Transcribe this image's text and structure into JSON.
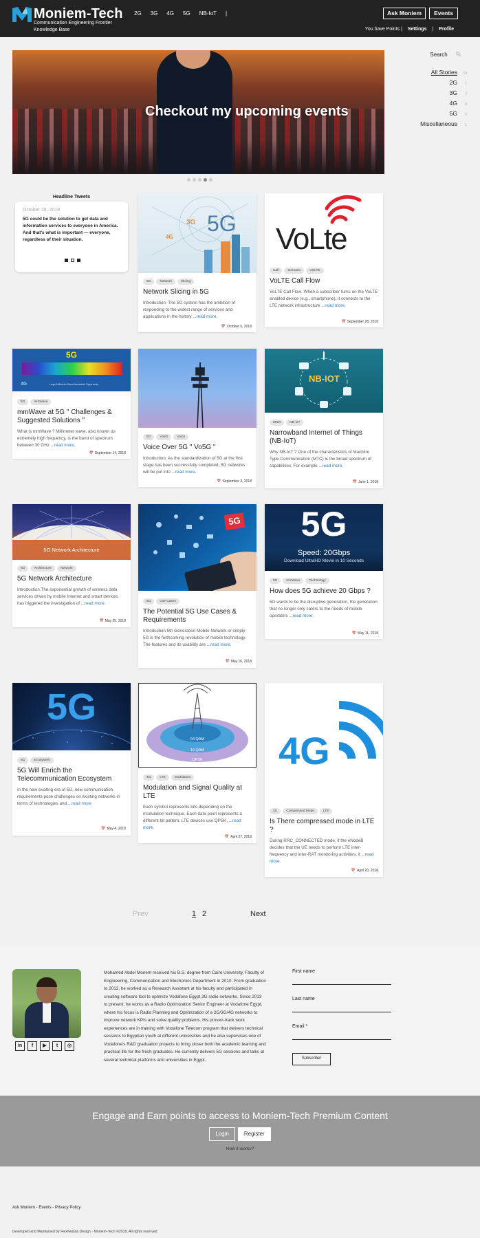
{
  "header": {
    "brand": "Moniem-Tech",
    "tagline_1": "Communication Engineering Frontier",
    "tagline_2": "Knowledge Base",
    "nav": [
      "2G",
      "3G",
      "4G",
      "5G",
      "NB-IoT",
      "|"
    ],
    "ask_button": "Ask Moniem",
    "events_button": "Events",
    "points_text": "You have Points",
    "settings_link": "Settings",
    "profile_link": "Profile"
  },
  "hero": {
    "caption": "Checkout my upcoming events"
  },
  "sidebar": {
    "search_label": "Search",
    "items": [
      {
        "label": "All Stories",
        "count": "19"
      },
      {
        "label": "2G",
        "count": "1"
      },
      {
        "label": "3G",
        "count": "2"
      },
      {
        "label": "4G",
        "count": "4"
      },
      {
        "label": "5G",
        "count": "5"
      },
      {
        "label": "Miscellaneous",
        "count": "1"
      }
    ]
  },
  "tweet": {
    "heading": "Headline Tweets",
    "date": "October 28, 2018",
    "text": "5G could be the solution to get data and information services to everyone in America. And that's what is important — everyone, regardless of their situation."
  },
  "cards": [
    {
      "img_text": "5G",
      "tags": [
        "5G",
        "Network",
        "Slicing"
      ],
      "title": "Network Slicing in 5G",
      "excerpt": "Introduction: The 5G system has the ambition of responding to the widest range of services and applications in the history ...",
      "read_more": "read more.",
      "date": "October 5, 2018"
    },
    {
      "img_text": "VoLte",
      "tags": [
        "Call",
        "Scenario",
        "VOLTE"
      ],
      "title": "VoLTE Call Flow",
      "excerpt": "VoLTE Call Flow: When a subscriber turns on the VoLTE enabled device (e.g., smartphone), it connects to the LTE network infrastructure ...",
      "read_more": "read more.",
      "date": "September 28, 2018"
    },
    {
      "img_text": "5G",
      "img_sub": "4G",
      "img_caption": "Large Millimeter Wave Bandwidth Opportunity",
      "tags": [
        "5G",
        "mmWave"
      ],
      "title": "mmWave at 5G \" Challenges & Suggested Solutions \"",
      "excerpt": "What is mmWave ?  Millimeter wave, also known as extremely high frequency, is the band of spectrum between 30 GHz ...",
      "read_more": "read more.",
      "date": "September 14, 2018"
    },
    {
      "tags": [
        "5G",
        "Vo5G",
        "Voice"
      ],
      "title": "Voice Over 5G \" Vo5G \"",
      "excerpt": "Introduction: As the standardization of 5G at the first stage has been successfully completed, 5G networks will be put into ...",
      "read_more": "read more.",
      "date": "September 3, 2018"
    },
    {
      "img_text": "NB-IOT",
      "tags": [
        "MNO",
        "NB-IoT"
      ],
      "title": "Narrowband Internet of Things (NB-IoT)",
      "excerpt": "Why NB-IoT ? One of the characteristics of Machine Type Communication (MTC) is the broad spectrum of capabilities. For example ...",
      "read_more": "read more.",
      "date": "June 1, 2018"
    },
    {
      "img_text": "5G Network Architecture",
      "tags": [
        "5G",
        "Architecture",
        "Network"
      ],
      "title": "5G Network Architecture",
      "excerpt": "Introduction  The exponential growth of wireless data services driven by mobile Internet and smart devices has triggered the investigation of ...",
      "read_more": "read more.",
      "date": "May 25, 2018"
    },
    {
      "img_text": "5G",
      "tags": [
        "5G",
        "Use Cases"
      ],
      "title": "The Potential 5G Use Cases & Requirements",
      "excerpt": "Introduction  5th Generation Mobile Network or simply 5G is the forthcoming revolution of mobile technology. The features and its usability are ...",
      "read_more": "read more.",
      "date": "May 16, 2018"
    },
    {
      "img_text": "5G",
      "img_sub": "Speed: 20Gbps",
      "img_caption": "Download UltraHD Movie in 10 Seconds",
      "tags": [
        "5G",
        "mmWave",
        "Technology"
      ],
      "title": "How does 5G achieve 20 Gbps ?",
      "excerpt": "5G wants to be the disruptive generation, the generation that no longer only caters to the needs of mobile operators ...",
      "read_more": "read more.",
      "date": "May 11, 2018"
    },
    {
      "img_text": "5G",
      "tags": [
        "5G",
        "Ecosystem"
      ],
      "title": "5G Will Enrich the Telecommunication Ecosystem",
      "excerpt": "In the new exciting era of 5G, new communication requirements pose challenges on existing networks in terms of technologies and ...",
      "read_more": "read more.",
      "date": "May 4, 2018"
    },
    {
      "img_text": "64 QAM",
      "img_sub": "16 QAM",
      "img_caption": "QPSK",
      "tags": [
        "4G",
        "LTE",
        "Modulation"
      ],
      "title": "Modulation and Signal Quality at LTE",
      "excerpt": "Each symbol represents bits depending on the modulation technique. Each data point represents a different bit pattern.    LTE devices use QPSK, ...",
      "read_more": "read more.",
      "date": "April 27, 2018"
    },
    {
      "img_text": "4G",
      "tags": [
        "4G",
        "Compressed Mode",
        "LTE"
      ],
      "title": "Is There compressed mode in LTE ?",
      "excerpt": "During RRC_CONNECTED mode, if the eNodeB decides that the UE needs to perform LTE inter-frequency and inter-RAT monitoring activities, it ...",
      "read_more": "read more.",
      "date": "April 20, 2018"
    }
  ],
  "pagination": {
    "prev": "Prev",
    "pages": [
      "1",
      "2"
    ],
    "next": "Next"
  },
  "bio": {
    "text": "Mohamed Abdel Monem received his B.S. degree from Cairo University, Faculty of Engineering, Communication and Electronics Department in 2010. From graduation to 2012, he worked as a Research Assistant at his faculty and participated in creating software tool to optimize Vodafone Egypt 3G radio networks. Since 2013 to present, he works as a Radio Optimization Senior Engineer at Vodafone Egypt, where his focus is Radio Planning and Optimization of a 2G/3G/4G networks to improve network KPIs and solve quality problems. His proven-track work experiences are in training with Vodafone Telecom program that delivers technical sessions to Egyptian youth at different universities and he also supervises one of Vodafone's R&D graduation projects to bring closer both the academic learning and practical life for the fresh graduates. He currently delivers 5G sessions and talks at several technical platforms and universities in Egypt.",
    "socials": [
      "in",
      "f",
      "yt",
      "tw",
      "ig"
    ]
  },
  "subscribe": {
    "first_name": "First name",
    "last_name": "Last name",
    "email": "Email *",
    "button": "Subscribe!"
  },
  "cta": {
    "heading": "Engage and Earn points to access to Moniem-Tech Premium Content",
    "login": "Login",
    "register": "Register",
    "how": "How it works?"
  },
  "footer": {
    "links": "Ask Moniem - Events - Privacy Policy",
    "copyright": "Developed and Maintained by FlexNebula Design - Moniem-Tech ©2018. All rights reserved."
  },
  "colors": {
    "header_bg": "#222222",
    "accent_link": "#2c7bc4",
    "cta_bg": "#9a9a9a"
  }
}
